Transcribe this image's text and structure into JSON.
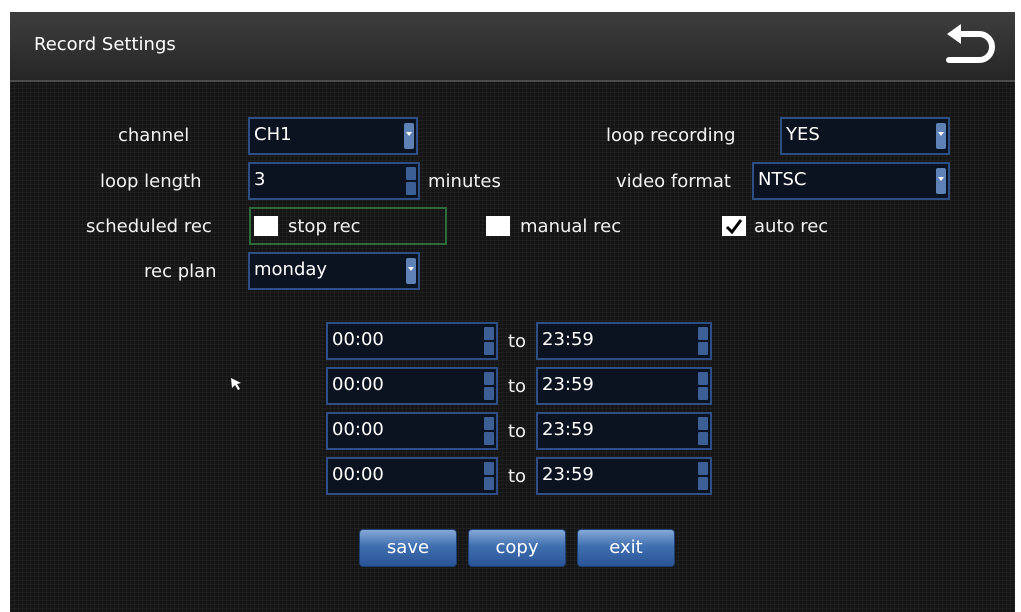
{
  "header": {
    "title": "Record Settings",
    "back_icon": "return-arrow-icon"
  },
  "settings": {
    "channel": {
      "label": "channel",
      "value": "CH1"
    },
    "loop_recording": {
      "label": "loop recording",
      "value": "YES"
    },
    "loop_length": {
      "label": "loop length",
      "value": "3",
      "unit": "minutes"
    },
    "video_format": {
      "label": "video format",
      "value": "NTSC"
    },
    "scheduled_rec": {
      "label": "scheduled rec"
    },
    "modes": [
      {
        "label": "stop rec",
        "checked": false
      },
      {
        "label": "manual rec",
        "checked": false
      },
      {
        "label": "auto rec",
        "checked": true
      }
    ],
    "rec_plan": {
      "label": "rec plan",
      "value": "monday"
    }
  },
  "schedule": {
    "to_label": "to",
    "rows": [
      {
        "start": "00:00",
        "end": "23:59"
      },
      {
        "start": "00:00",
        "end": "23:59"
      },
      {
        "start": "00:00",
        "end": "23:59"
      },
      {
        "start": "00:00",
        "end": "23:59"
      }
    ]
  },
  "buttons": {
    "save": "save",
    "copy": "copy",
    "exit": "exit"
  },
  "colors": {
    "field_border": "#2d4f86",
    "button_blue": "#3f6fb0",
    "stop_rec_focus": "#2f6a3a"
  }
}
